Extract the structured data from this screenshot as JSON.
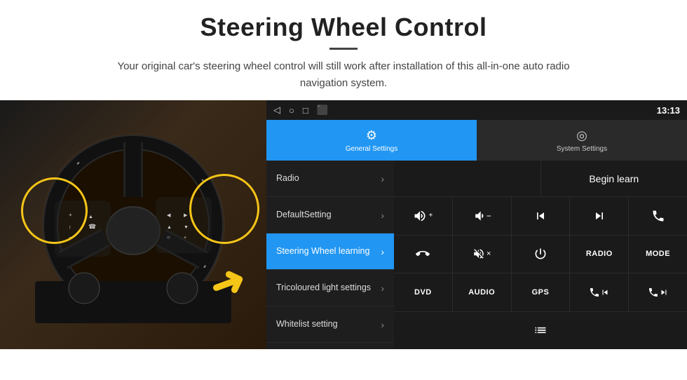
{
  "header": {
    "title": "Steering Wheel Control",
    "divider": true,
    "subtitle": "Your original car's steering wheel control will still work after installation of this all-in-one auto radio navigation system."
  },
  "statusBar": {
    "icons": [
      "◁",
      "○",
      "□",
      "⬛"
    ],
    "rightInfo": "13:13",
    "wifiIcon": "▼",
    "signalIcon": "▾"
  },
  "tabs": [
    {
      "id": "general",
      "label": "General Settings",
      "icon": "⚙",
      "active": true
    },
    {
      "id": "system",
      "label": "System Settings",
      "icon": "◎",
      "active": false
    }
  ],
  "menu": {
    "items": [
      {
        "id": "radio",
        "label": "Radio",
        "active": false
      },
      {
        "id": "defaultsetting",
        "label": "DefaultSetting",
        "active": false
      },
      {
        "id": "steering",
        "label": "Steering Wheel learning",
        "active": true
      },
      {
        "id": "tricoloured",
        "label": "Tricoloured light settings",
        "active": false
      },
      {
        "id": "whitelist",
        "label": "Whitelist setting",
        "active": false
      }
    ]
  },
  "controls": {
    "beginLearn": "Begin learn",
    "rows": [
      [
        {
          "type": "icon",
          "icon": "vol_up",
          "symbol": "🔊+",
          "label": "volume-up"
        },
        {
          "type": "icon",
          "icon": "vol_down",
          "symbol": "🔊−",
          "label": "volume-down"
        },
        {
          "type": "icon",
          "icon": "prev_track",
          "symbol": "⏮",
          "label": "prev-track"
        },
        {
          "type": "icon",
          "icon": "next_track",
          "symbol": "⏭",
          "label": "next-track"
        },
        {
          "type": "icon",
          "icon": "phone",
          "symbol": "📞",
          "label": "phone"
        }
      ],
      [
        {
          "type": "icon",
          "icon": "hang_up",
          "symbol": "↩",
          "label": "hang-up"
        },
        {
          "type": "text+icon",
          "icon": "vol_mute",
          "symbol": "🔊×",
          "label": "mute"
        },
        {
          "type": "icon",
          "icon": "power",
          "symbol": "⏻",
          "label": "power"
        },
        {
          "type": "text",
          "text": "RADIO",
          "label": "radio-btn"
        },
        {
          "type": "text",
          "text": "MODE",
          "label": "mode-btn"
        }
      ],
      [
        {
          "type": "text",
          "text": "DVD",
          "label": "dvd-btn"
        },
        {
          "type": "text",
          "text": "AUDIO",
          "label": "audio-btn"
        },
        {
          "type": "text",
          "text": "GPS",
          "label": "gps-btn"
        },
        {
          "type": "icon",
          "icon": "phone_prev",
          "symbol": "📞⏮",
          "label": "phone-prev"
        },
        {
          "type": "icon",
          "icon": "phone_next",
          "symbol": "📞⏭",
          "label": "phone-next"
        }
      ],
      [
        {
          "type": "icon",
          "icon": "list",
          "symbol": "≡",
          "label": "list-icon",
          "single": true
        }
      ]
    ]
  }
}
